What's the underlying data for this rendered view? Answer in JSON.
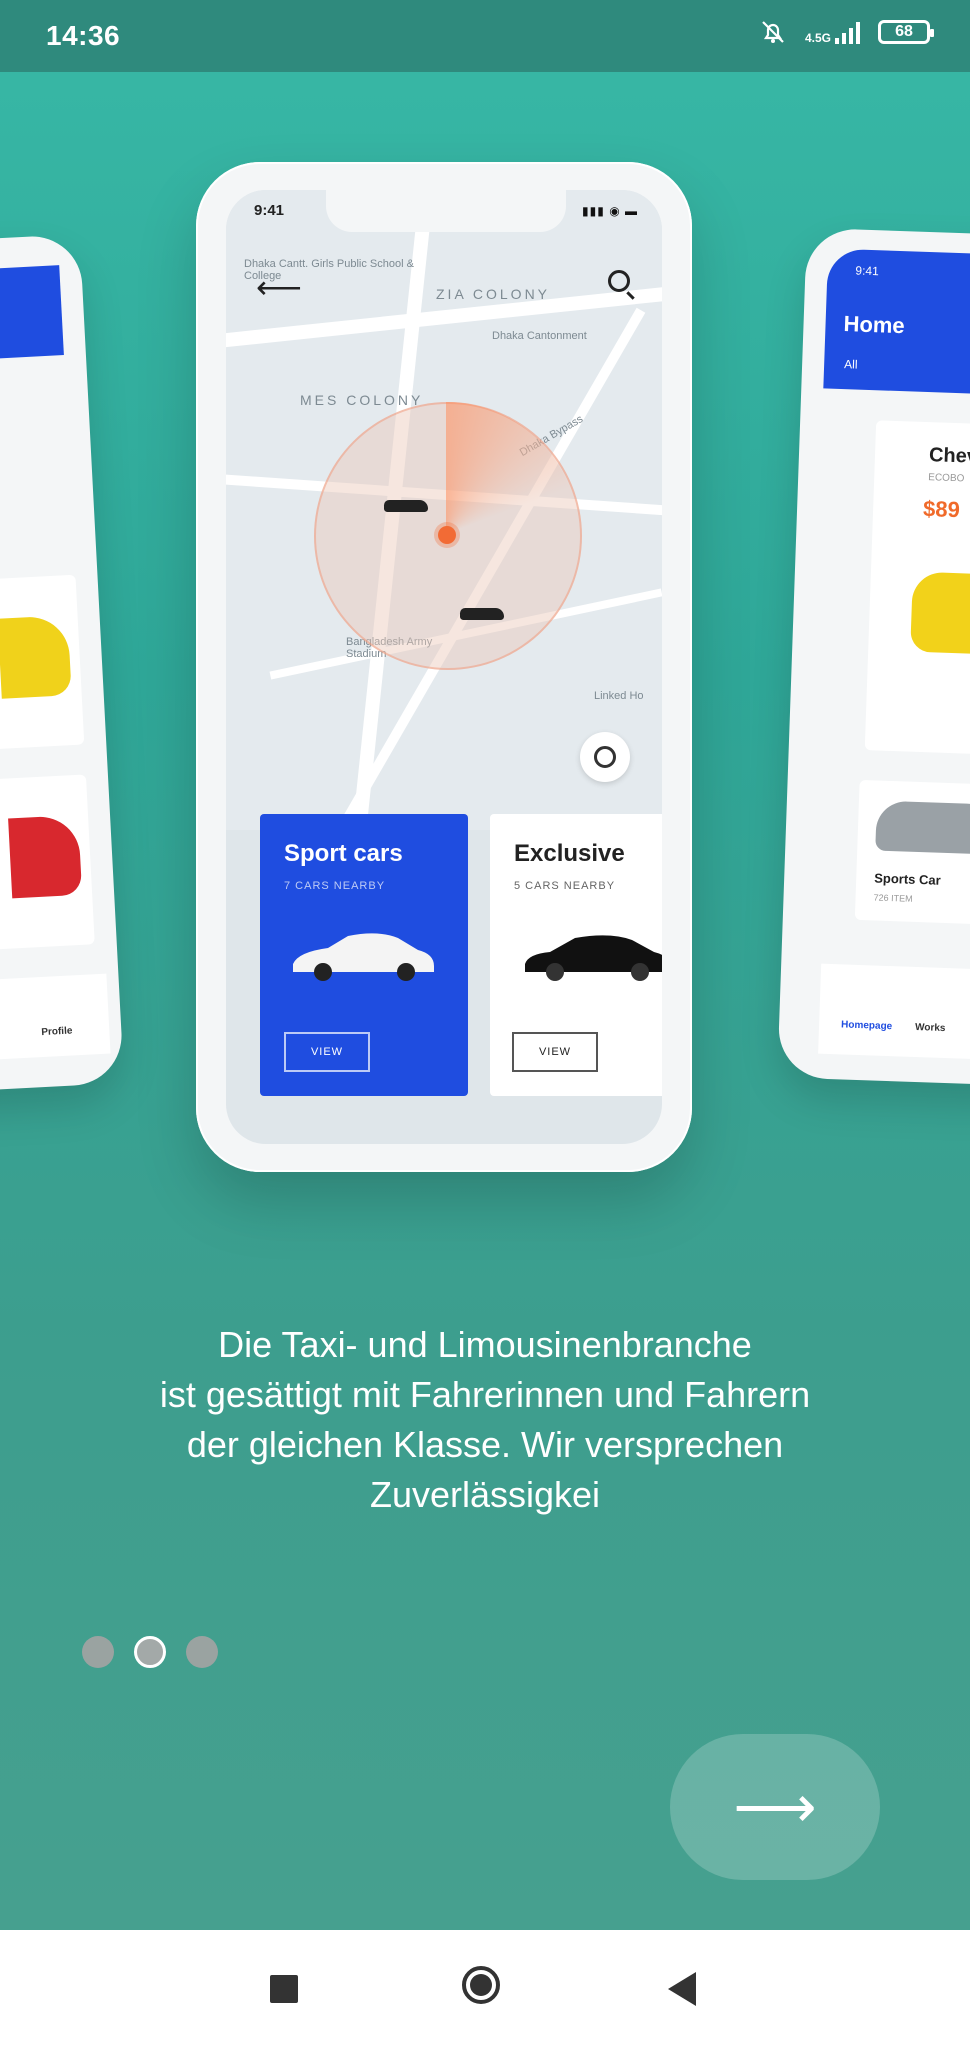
{
  "status_bar": {
    "time": "14:36",
    "network": "4.5G",
    "battery": "68",
    "icons": [
      "bell-off-icon",
      "signal-icon",
      "battery-icon"
    ]
  },
  "mockup": {
    "main_phone": {
      "time": "9:41",
      "map_labels": {
        "colony1": "ZIA COLONY",
        "colony2": "MES COLONY",
        "school": "Dhaka Cantt. Girls Public School & College",
        "cantonment": "Dhaka Cantonment",
        "stadium": "Bangladesh Army Stadium",
        "road": "Dhaka Bypass",
        "hotel": "Linked Ho"
      },
      "cards": [
        {
          "title": "Sport cars",
          "subtitle": "7 CARS NEARBY",
          "button": "VIEW"
        },
        {
          "title": "Exclusive",
          "subtitle": "5 CARS NEARBY",
          "button": "VIEW"
        }
      ]
    },
    "right_phone": {
      "time": "9:41",
      "header": "Home",
      "filter": "All",
      "car_name": "Chevy",
      "car_sub": "ECOBO",
      "price": "$89",
      "card2_label": "Sports Car",
      "card2_sub": "726 ITEM",
      "nav": [
        "Homepage",
        "Works"
      ]
    },
    "left_phone": {
      "nav": "Profile"
    }
  },
  "onboarding": {
    "caption_lines": [
      "Die Taxi- und Limousinenbranche",
      "ist gesättigt mit Fahrerinnen und Fahrern",
      "der gleichen Klasse. Wir versprechen",
      "Zuverlässigkei"
    ],
    "page_count": 3,
    "active_page": 2,
    "next_icon": "arrow-right-icon",
    "next_symbol": "⟶"
  },
  "system_nav": {
    "buttons": [
      "recents",
      "home",
      "back"
    ]
  },
  "colors": {
    "teal": "#38b8a6",
    "status_bar": "#2f8a7d",
    "card_blue": "#1f4de0",
    "accent_orange": "#f26b35"
  }
}
